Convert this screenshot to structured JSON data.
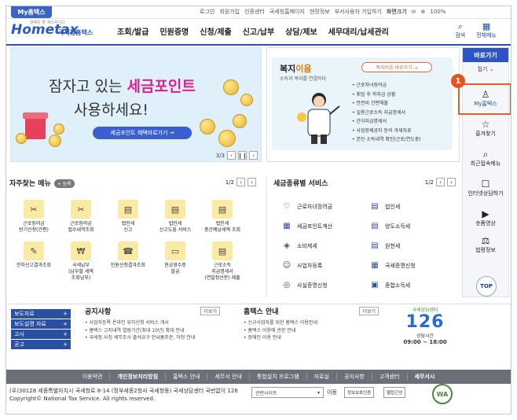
{
  "topbar": {
    "my_tab": "My홈택스",
    "utils": [
      "로그인",
      "회원가입",
      "인증센터",
      "국세청홈페이지",
      "현장정보",
      "부서사용자 가입하기",
      "화면크기",
      "100%"
    ]
  },
  "header": {
    "logo_main": "Hometax",
    "logo_tagline": "언제든 할 세스하시다",
    "logo_korean": "국세청홈택스",
    "gnb": [
      "조회/발급",
      "민원증명",
      "신청/제출",
      "신고/납부",
      "상담/제보",
      "세무대리/납세관리"
    ],
    "search_label": "검색",
    "allmenu_label": "전체메뉴"
  },
  "banner": {
    "headline_plain": "잠자고 있는 ",
    "headline_pink": "세금포인트",
    "headline2": "사용하세요!",
    "button": "세금포인트 혜택바로가기 →",
    "pager": "3/3"
  },
  "welfare": {
    "title_plain": "복지",
    "title_accent": "이음",
    "subtitle": "소득과 복지를 연결하다",
    "button": "복지이음 바로가기 →",
    "items": [
      "근로자녀장려금",
      "취업 후 학자금 상황",
      "안전비 건편해볼",
      "일용근로소득 지급명세서",
      "간이지급명세서",
      "사업장제공자 등의 과세자료",
      "본인 소득내역 확인(근로/연도중)"
    ]
  },
  "side": {
    "top": "바로가기",
    "fold": "접기 ⌄",
    "items": [
      {
        "icon": "person-icon",
        "glyph": "♙",
        "label": "My홈택스"
      },
      {
        "icon": "star-icon",
        "glyph": "☆",
        "label": "즐겨찾기"
      },
      {
        "icon": "search-person-icon",
        "glyph": "⌕",
        "label": "최근접속메뉴"
      },
      {
        "icon": "chat-icon",
        "glyph": "☐",
        "label": "인터넷상담하기"
      },
      {
        "icon": "play-icon",
        "glyph": "▶",
        "label": "숏폼영상"
      },
      {
        "icon": "gavel-icon",
        "glyph": "⚖",
        "label": "법령정보"
      }
    ],
    "top_button": "TOP",
    "callout_number": "1"
  },
  "favorites": {
    "title": "자주찾는 메뉴",
    "add": "+ 등록",
    "pager": "1/2",
    "items": [
      {
        "glyph": "✂",
        "label": "근로장려금\n반기신청(간편)"
      },
      {
        "glyph": "✂",
        "label": "근로장려금\n접수내역조회"
      },
      {
        "glyph": "▤",
        "label": "법인세\n신고"
      },
      {
        "glyph": "▤",
        "label": "법인세\n신고도움 서비스"
      },
      {
        "glyph": "▤",
        "label": "법인세\n중간예납세액 조회"
      },
      {
        "glyph": "✎",
        "label": "전자신고결과조회"
      },
      {
        "glyph": "₩",
        "label": "국세납부\n(납부할 세액\n조회납부)"
      },
      {
        "glyph": "☎",
        "label": "민원신청결과조회"
      },
      {
        "glyph": "▭",
        "label": "현금영수증\n발급"
      },
      {
        "glyph": "▤",
        "label": "근로소득\n지급명세서\n(연말정산분) 제출"
      }
    ]
  },
  "services": {
    "title": "세금종류별 서비스",
    "pager": "1/2",
    "items": [
      {
        "glyph": "♡",
        "label": "근로자녀장려금"
      },
      {
        "glyph": "▤",
        "label": "법인세"
      },
      {
        "glyph": "▦",
        "label": "세금포인트계산"
      },
      {
        "glyph": "▤",
        "label": "양도소득세"
      },
      {
        "glyph": "◈",
        "label": "소비제세"
      },
      {
        "glyph": "▤",
        "label": "원천세"
      },
      {
        "glyph": "☺",
        "label": "사업자등록"
      },
      {
        "glyph": "▦",
        "label": "국세증명신청"
      },
      {
        "glyph": "◎",
        "label": "사실증명신청"
      },
      {
        "glyph": "▣",
        "label": "종합소득세"
      }
    ]
  },
  "bottom": {
    "qlinks": [
      "보도자료",
      "보도설명 자료",
      "고시",
      "공고"
    ],
    "notice": {
      "title": "공지사항",
      "more": "더보기",
      "items": [
        "사업자등록 온라인 위하신청 서비스 개시",
        "홈택스 고지내역 열람기간(최대 10년) 확대 안내",
        "국세청 사칭 세무조사 출석요구 안내홈주문, 하청 안내"
      ]
    },
    "hometax": {
      "title": "홈택스 안내",
      "more": "더보기",
      "items": [
        "신규사업자를 위한 홈택스 이용안내",
        "홈택스 이용에 관한 안내",
        "장애인 이용 안내"
      ]
    },
    "call": {
      "slogan": "국세상담센터",
      "number": "126",
      "time_label": "상담시간",
      "hours": "09:00 ~ 18:00"
    }
  },
  "footer": {
    "nav": [
      "이용약관",
      "개인정보처리방침",
      "홈택스 안내",
      "세무서 안내",
      "통합설치 프로그램",
      "자료실",
      "공지사항",
      "고객센터",
      "세무서시"
    ],
    "copy1": "(우)30128 세종특별자치시 국세청로 8-14 (정부세종2청사 국세청동) 국세상담센터 국번없이 126",
    "copy2": "Copyright© National Tax Service. All rights reserved.",
    "select": "관련사이트",
    "go": "이동",
    "badge1": "정보보호인증",
    "badge2": "웹접근성",
    "wa": "WA"
  }
}
